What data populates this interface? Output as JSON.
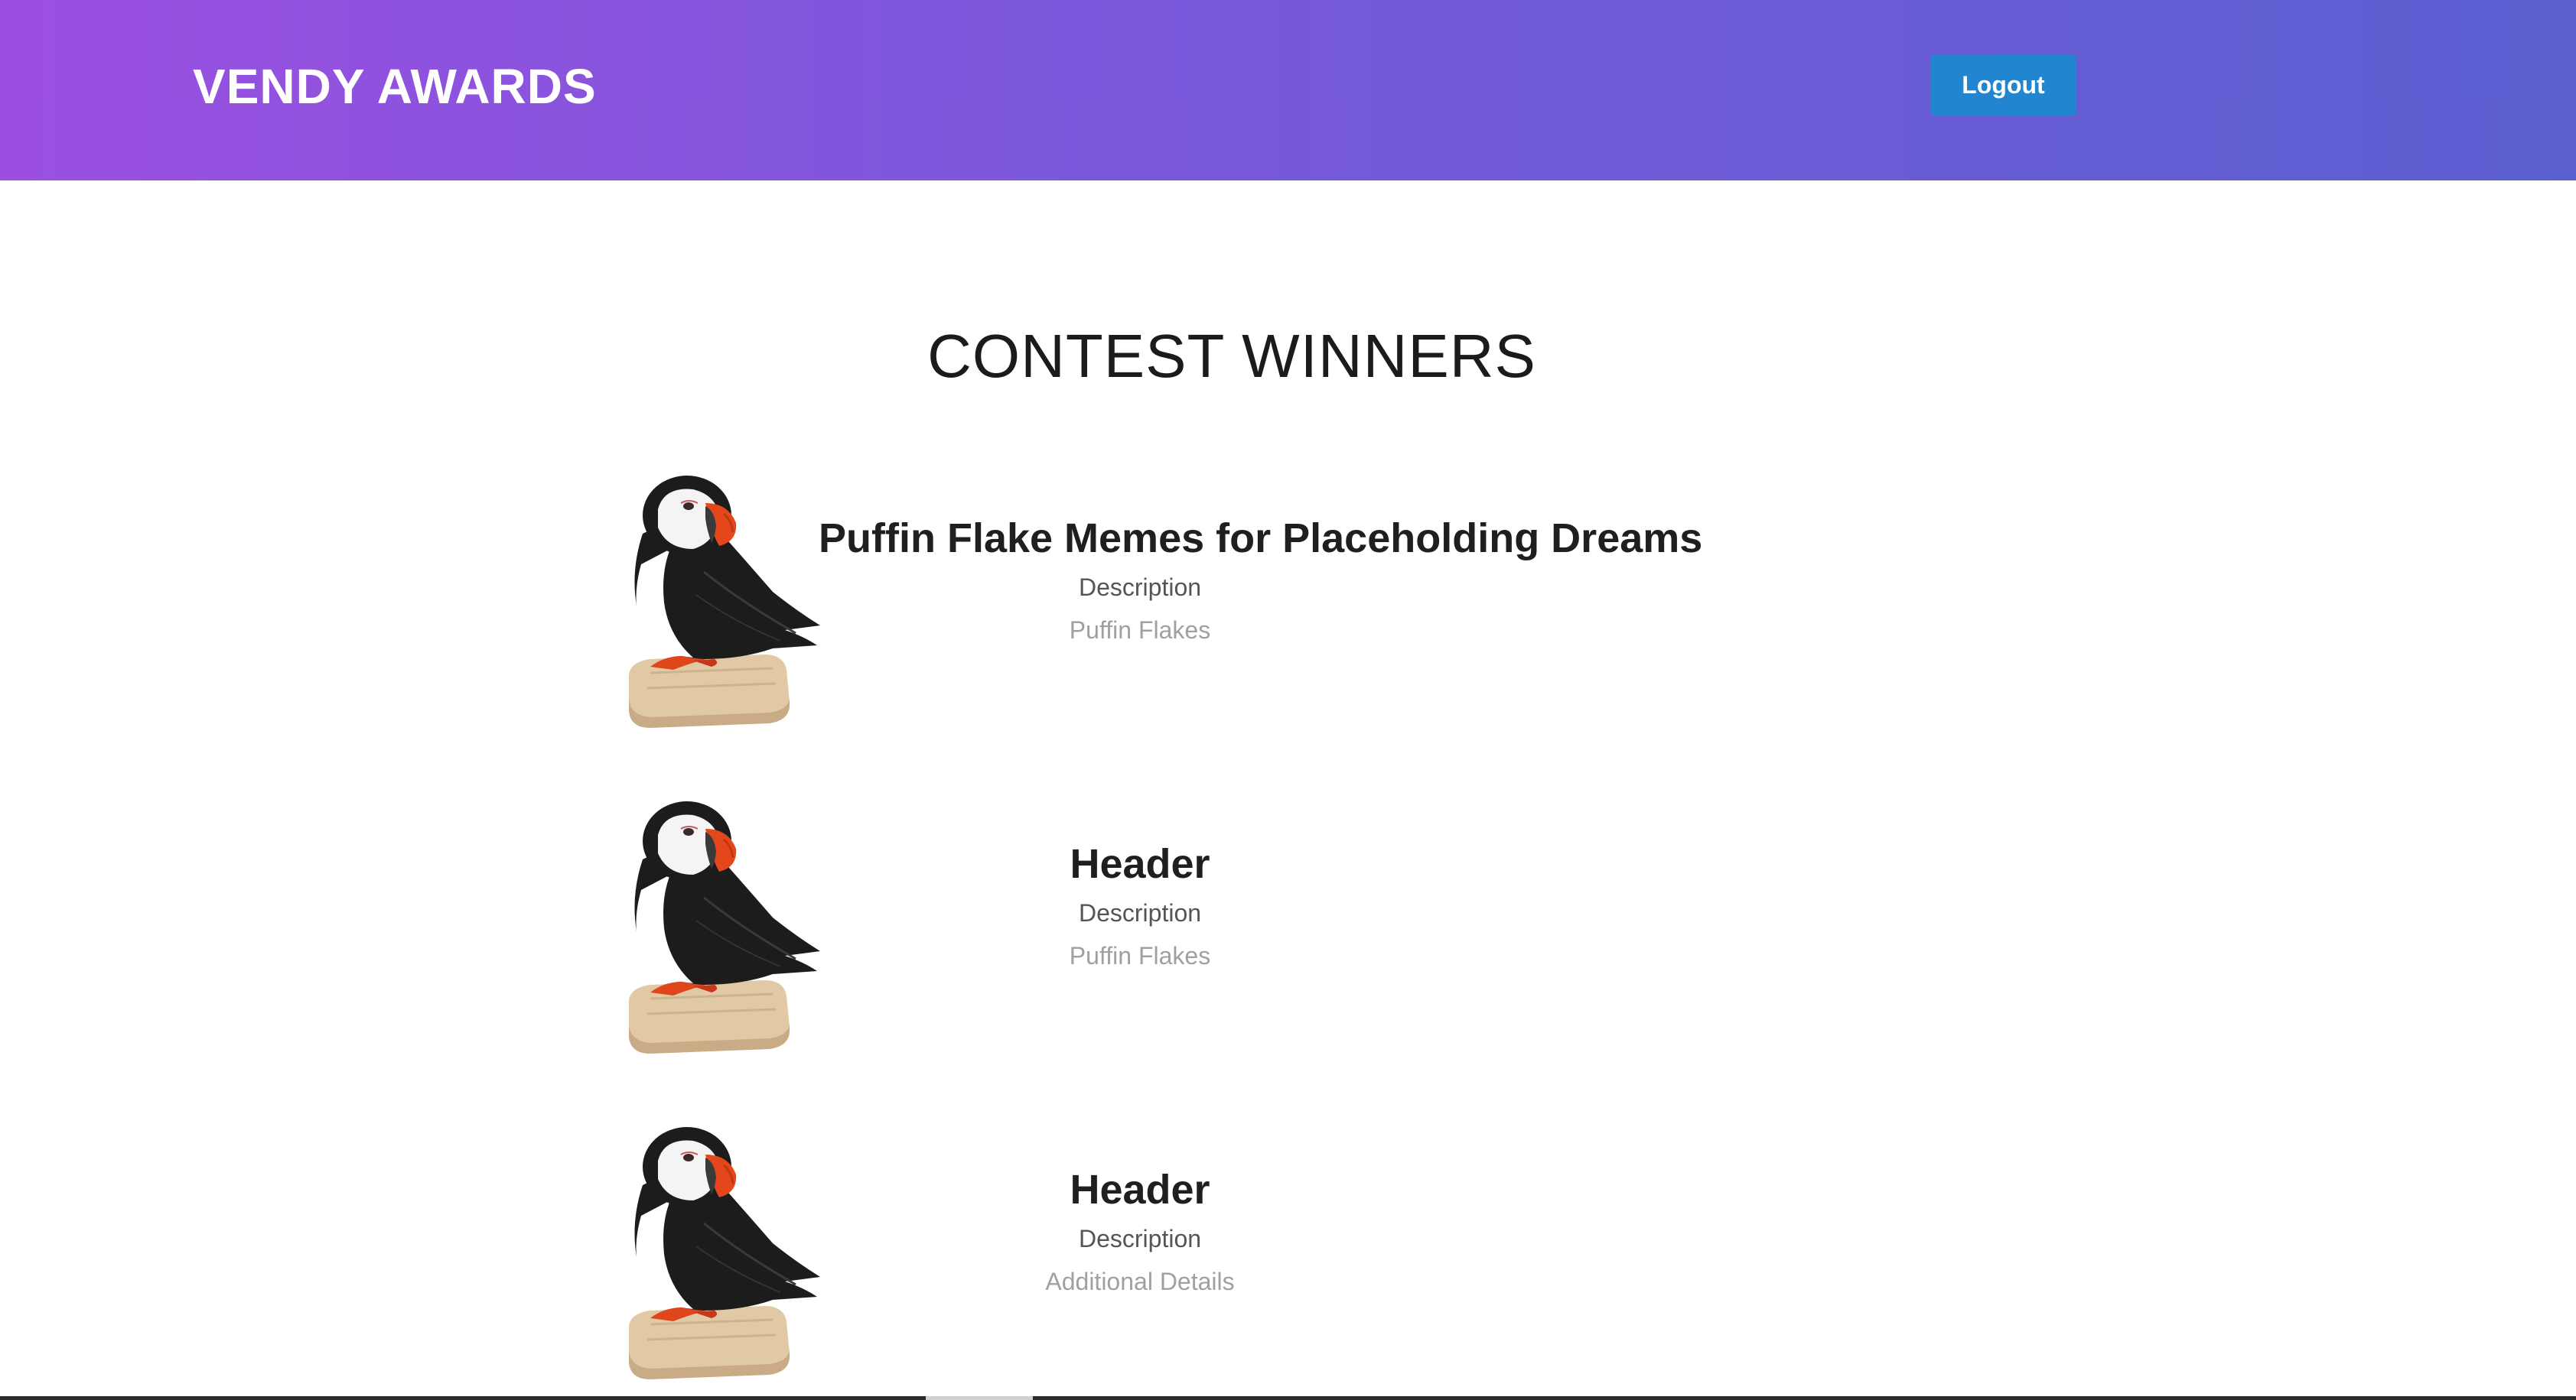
{
  "header": {
    "brand": "VENDY AWARDS",
    "logout_label": "Logout"
  },
  "main": {
    "title": "CONTEST WINNERS",
    "winners": [
      {
        "title": "Puffin Flake Memes for Placeholding Dreams",
        "description": "Description",
        "extra": "Puffin Flakes",
        "image": "puffin-image"
      },
      {
        "title": "Header",
        "description": "Description",
        "extra": "Puffin Flakes",
        "image": "puffin-image"
      },
      {
        "title": "Header",
        "description": "Description",
        "extra": "Additional Details",
        "image": "puffin-image"
      }
    ]
  },
  "colors": {
    "header_gradient_start": "#9b4fe0",
    "header_gradient_end": "#5a5fd0",
    "button": "#2185d0"
  }
}
